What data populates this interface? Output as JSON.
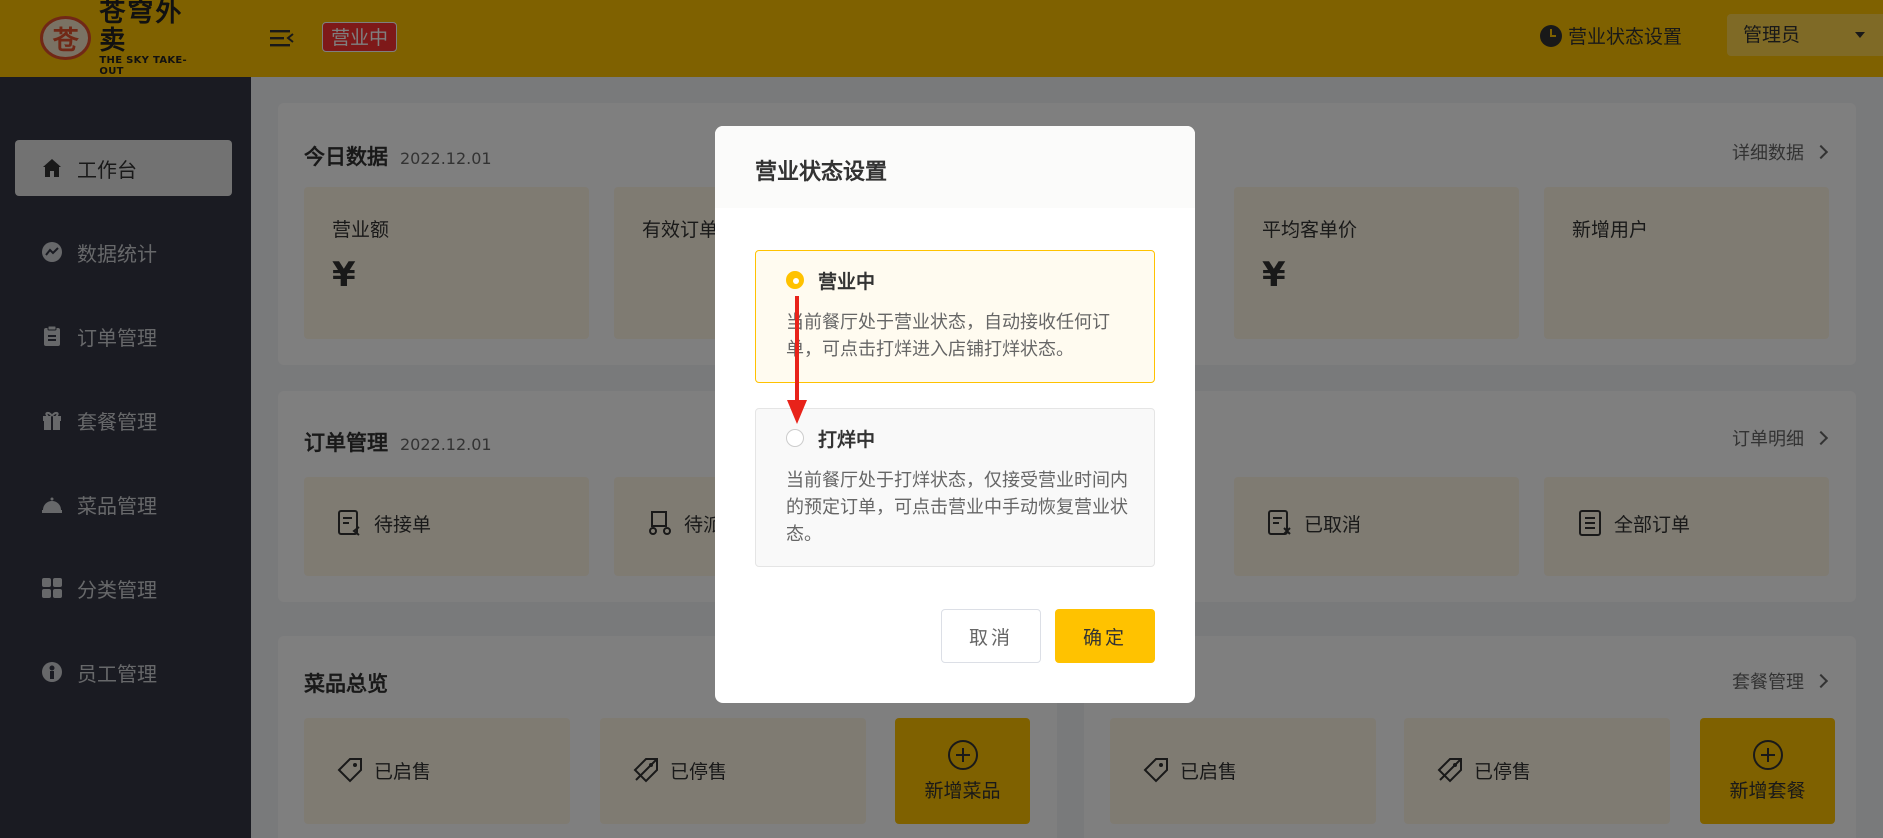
{
  "header": {
    "logo_cn": "苍穹外卖",
    "logo_en": "THE SKY TAKE-OUT",
    "status_tag": "营业中",
    "status_setting": "营业状态设置",
    "user": "管理员"
  },
  "sidebar": {
    "items": [
      {
        "label": "工作台",
        "icon": "home-icon"
      },
      {
        "label": "数据统计",
        "icon": "chart-icon"
      },
      {
        "label": "订单管理",
        "icon": "clipboard-icon"
      },
      {
        "label": "套餐管理",
        "icon": "gift-icon"
      },
      {
        "label": "菜品管理",
        "icon": "dish-icon"
      },
      {
        "label": "分类管理",
        "icon": "grid-icon"
      },
      {
        "label": "员工管理",
        "icon": "user-icon"
      }
    ]
  },
  "today": {
    "title": "今日数据",
    "date": "2022.12.01",
    "link": "详细数据",
    "tiles": [
      {
        "label": "营业额",
        "value": "¥"
      },
      {
        "label": "有效订单",
        "value": ""
      },
      {
        "label": "平均客单价",
        "value": "¥"
      },
      {
        "label": "新增用户",
        "value": ""
      }
    ]
  },
  "orders": {
    "title": "订单管理",
    "date": "2022.12.01",
    "link": "订单明细",
    "tiles": [
      {
        "label": "待接单"
      },
      {
        "label": "待派"
      },
      {
        "label": "已取消"
      },
      {
        "label": "全部订单"
      }
    ]
  },
  "dishes": {
    "title": "菜品总览",
    "on": "已启售",
    "off": "已停售",
    "add": "新增菜品"
  },
  "setmeals": {
    "link": "套餐管理",
    "on": "已启售",
    "off": "已停售",
    "add": "新增套餐"
  },
  "modal": {
    "title": "营业状态设置",
    "options": [
      {
        "label": "营业中",
        "desc": "当前餐厅处于营业状态，自动接收任何订单，可点击打烊进入店铺打烊状态。",
        "selected": true
      },
      {
        "label": "打烊中",
        "desc": "当前餐厅处于打烊状态，仅接受营业时间内的预定订单，可点击营业中手动恢复营业状态。",
        "selected": false
      }
    ],
    "cancel": "取消",
    "confirm": "确定"
  },
  "colors": {
    "brand": "#ffc200",
    "sidebar": "#343744",
    "tag": "#fd3333",
    "annotation": "#e8231a"
  }
}
